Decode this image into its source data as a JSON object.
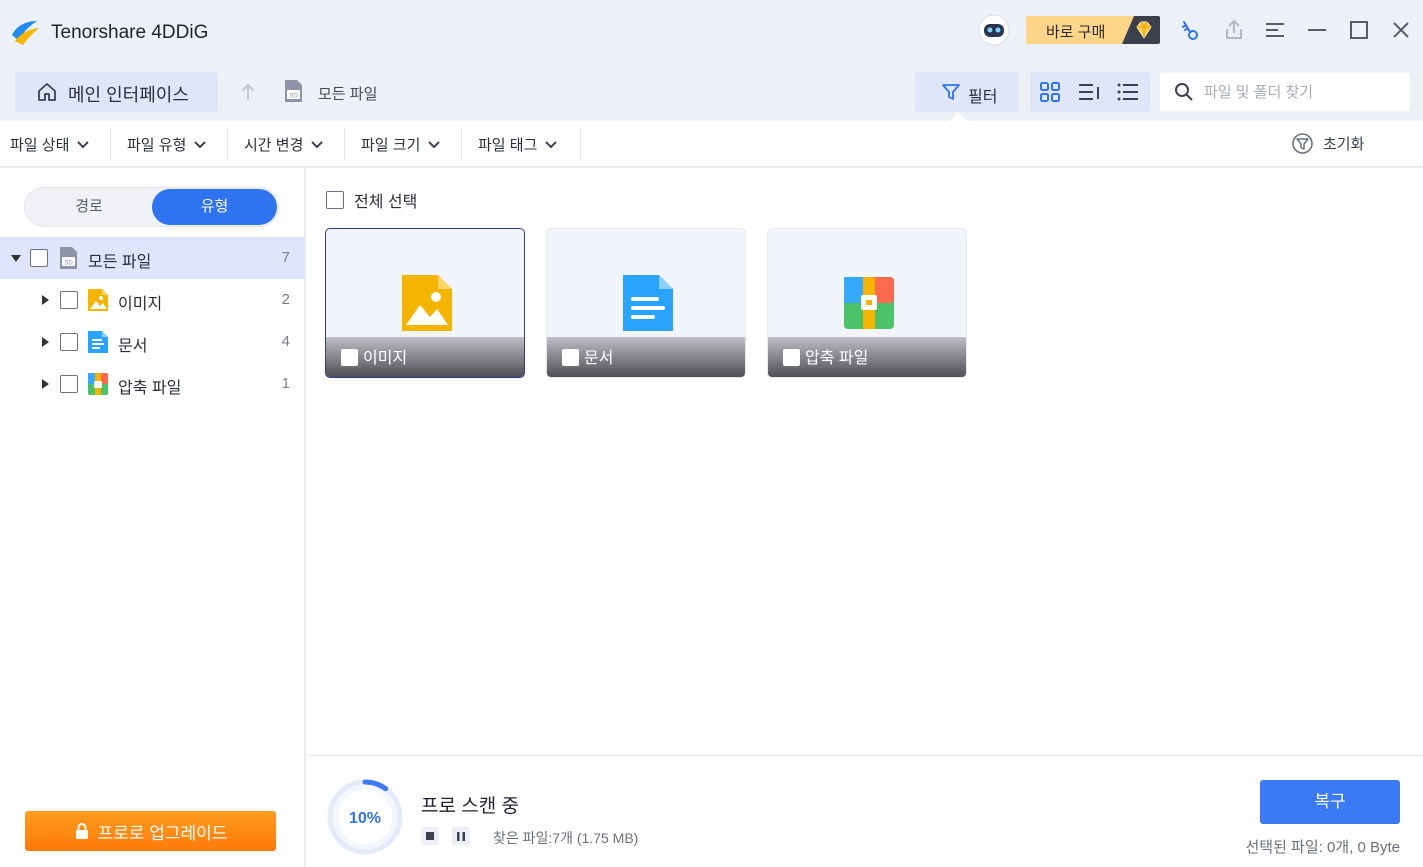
{
  "app": {
    "title": "Tenorshare 4DDiG"
  },
  "titlebar": {
    "buy_label": "바로 구매",
    "icons": [
      "robot-icon",
      "key-icon",
      "share-icon",
      "menu-icon",
      "minimize-icon",
      "maximize-icon",
      "close-icon"
    ]
  },
  "toolbar": {
    "home_label": "메인 인터페이스",
    "breadcrumb_label": "모든 파일",
    "filter_label": "필터",
    "search_placeholder": "파일 및 폴더 찾기"
  },
  "filters": {
    "items": [
      "파일 상태",
      "파일 유형",
      "시간 변경",
      "파일 크기",
      "파일 태그"
    ],
    "reset_label": "초기화"
  },
  "sidebar": {
    "seg_path": "경로",
    "seg_type": "유형",
    "tree": [
      {
        "label": "모든 파일",
        "count": "7"
      },
      {
        "label": "이미지",
        "count": "2"
      },
      {
        "label": "문서",
        "count": "4"
      },
      {
        "label": "압축 파일",
        "count": "1"
      }
    ],
    "upgrade_label": "프로로 업그레이드"
  },
  "main": {
    "select_all_label": "전체 선택",
    "cards": [
      {
        "label": "이미지"
      },
      {
        "label": "문서"
      },
      {
        "label": "압축 파일"
      }
    ]
  },
  "bottom": {
    "progress_label": "10%",
    "progress_value": 0.1,
    "scan_title": "프로 스캔 중",
    "found_text": "찾은 파일:7개 (1.75 MB)",
    "recover_label": "복구",
    "selected_text": "선택된 파일: 0개, 0 Byte"
  },
  "colors": {
    "accent": "#2f73f0",
    "upgrade": "#ff8a12",
    "buy": "#ffd58a"
  }
}
